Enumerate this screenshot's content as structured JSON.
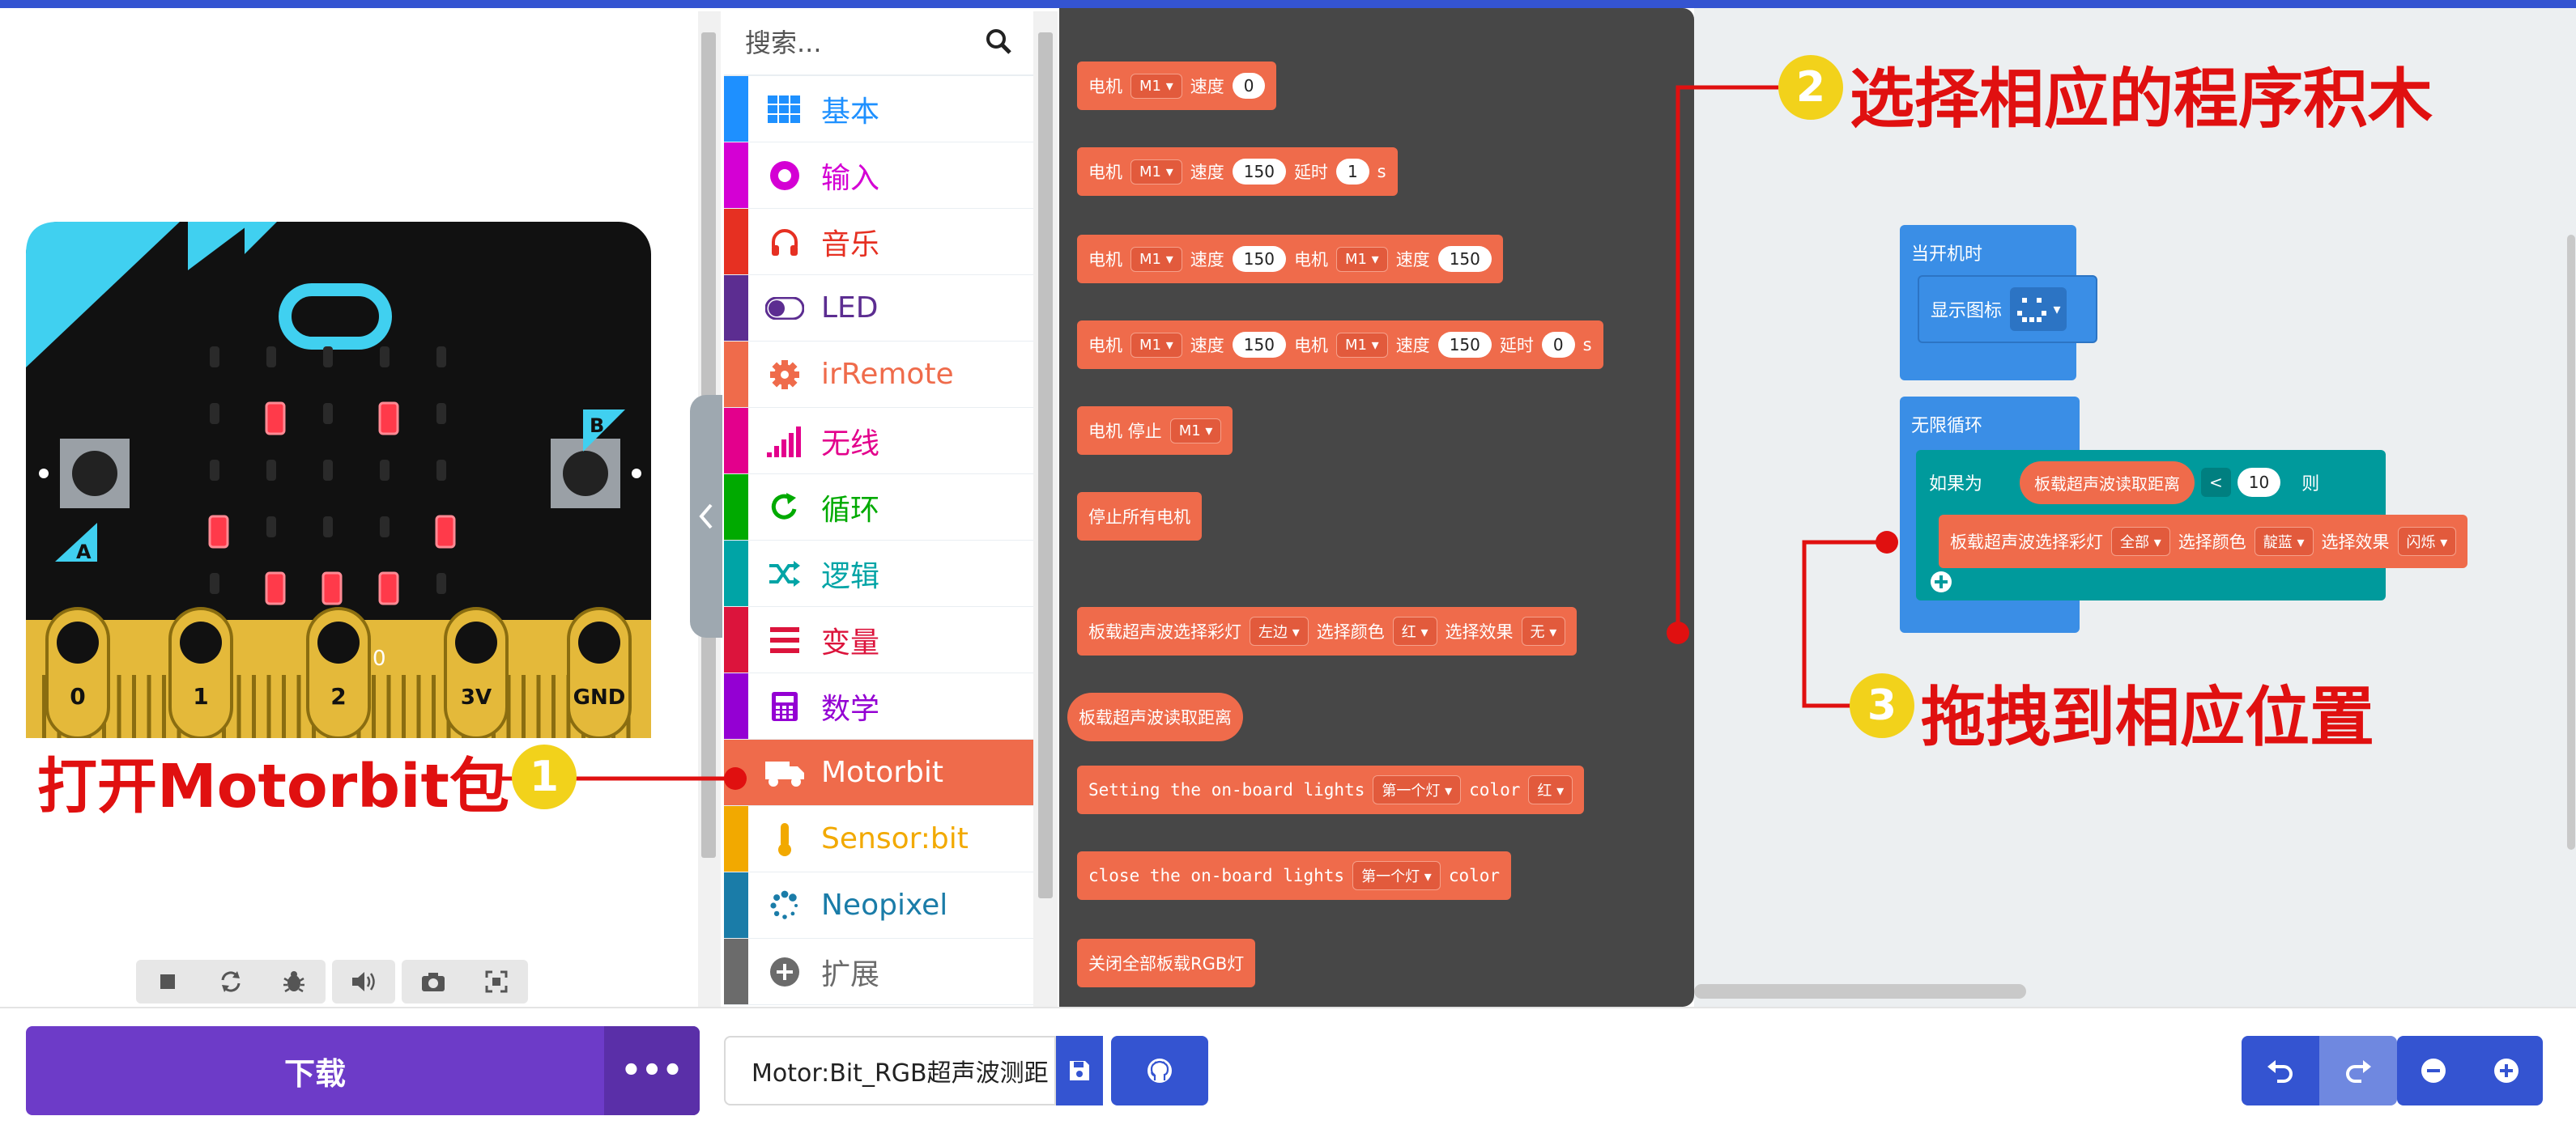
{
  "toolbox": {
    "search_placeholder": "搜索...",
    "categories": [
      {
        "label": "基本",
        "color": "#1e90ff",
        "icon": "grid-icon"
      },
      {
        "label": "输入",
        "color": "#d400d4",
        "icon": "target-icon"
      },
      {
        "label": "音乐",
        "color": "#e63022",
        "icon": "headphones-icon"
      },
      {
        "label": "LED",
        "color": "#5c2d91",
        "icon": "toggle-icon"
      },
      {
        "label": "irRemote",
        "color": "#ef6b4b",
        "icon": "gear-icon"
      },
      {
        "label": "无线",
        "color": "#e3008c",
        "icon": "signal-bars-icon"
      },
      {
        "label": "循环",
        "color": "#00aa00",
        "icon": "loop-arrow-icon"
      },
      {
        "label": "逻辑",
        "color": "#00a4a6",
        "icon": "shuffle-icon"
      },
      {
        "label": "变量",
        "color": "#dc143c",
        "icon": "list-lines-icon"
      },
      {
        "label": "数学",
        "color": "#9400d3",
        "icon": "calculator-icon"
      },
      {
        "label": "Motorbit",
        "color": "#ef6b4b",
        "icon": "truck-icon"
      },
      {
        "label": "Sensor:bit",
        "color": "#f2a900",
        "icon": "thermometer-icon"
      },
      {
        "label": "Neopixel",
        "color": "#1a7ca8",
        "icon": "dots-ring-icon"
      },
      {
        "label": "扩展",
        "color": "#6b6b6b",
        "icon": "plus-circle-icon"
      }
    ]
  },
  "flyout": {
    "b1": {
      "motor": "电机",
      "m": "M1",
      "speed": "速度",
      "v": "0"
    },
    "b2": {
      "motor": "电机",
      "m": "M1",
      "speed": "速度",
      "v": "150",
      "delay": "延时",
      "t": "1",
      "s": "s"
    },
    "b3": {
      "motor": "电机",
      "m": "M1",
      "speed": "速度",
      "v": "150",
      "motor2": "电机",
      "m2": "M1",
      "speed2": "速度",
      "v2": "150"
    },
    "b4": {
      "motor": "电机",
      "m": "M1",
      "speed": "速度",
      "v": "150",
      "motor2": "电机",
      "m2": "M1",
      "speed2": "速度",
      "v2": "150",
      "delay": "延时",
      "t": "0",
      "s": "s"
    },
    "b5": {
      "label": "电机 停止",
      "m": "M1"
    },
    "b6": {
      "label": "停止所有电机"
    },
    "b7": {
      "label": "板载超声波选择彩灯",
      "pos": "左边",
      "color_label": "选择颜色",
      "color": "红",
      "effect_label": "选择效果",
      "effect": "无"
    },
    "b8": {
      "label": "板载超声波读取距离"
    },
    "b9": {
      "label": "Setting the on-board lights",
      "which": "第一个灯",
      "color_label": "color",
      "color": "红"
    },
    "b10": {
      "label": "close the on-board lights",
      "which": "第一个灯",
      "color_label": "color"
    },
    "b11": {
      "label": "关闭全部板载RGB灯"
    }
  },
  "workspace": {
    "on_start": "当开机时",
    "show_icon": "显示图标",
    "forever": "无限循环",
    "if_label": "如果为",
    "read_distance": "板载超声波读取距离",
    "op": "<",
    "num": "10",
    "then": "则",
    "select_light": "板载超声波选择彩灯",
    "all": "全部",
    "color_label": "选择颜色",
    "color": "靛蓝",
    "effect_label": "选择效果",
    "effect": "闪烁"
  },
  "simulator": {
    "pins": [
      "0",
      "1",
      "2",
      "3V",
      "GND"
    ],
    "button_a": "A",
    "button_b": "B",
    "pin_value": "0"
  },
  "bottom": {
    "download": "下载",
    "more": "•••",
    "project_name": "Motor:Bit_RGB超声波测距"
  },
  "annotations": {
    "step1": "打开Motorbit包",
    "step1_num": "1",
    "step2": "选择相应的程序积木",
    "step2_num": "2",
    "step3": "拖拽到相应位置",
    "step3_num": "3"
  },
  "colors": {
    "accent": "#3454d1",
    "motorbit": "#ef6b4b",
    "download": "#6d3bc8",
    "annotation": "#e01010",
    "badge": "#f2d21b",
    "block_blue": "#3a8ee6",
    "block_teal": "#009a9c"
  }
}
